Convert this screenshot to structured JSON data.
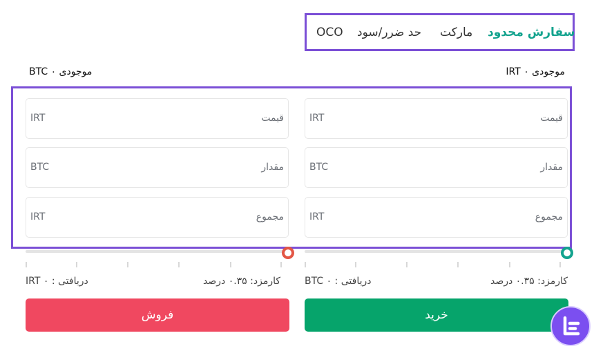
{
  "tabs": [
    {
      "id": "limit",
      "label": "سفارش محدود",
      "active": true
    },
    {
      "id": "market",
      "label": "مارکت",
      "active": false
    },
    {
      "id": "stop",
      "label": "حد ضرر/سود",
      "active": false
    },
    {
      "id": "oco",
      "label": "OCO",
      "active": false
    }
  ],
  "buy": {
    "balance": "موجودی ۰ IRT",
    "price": {
      "label": "قیمت",
      "unit": "IRT"
    },
    "amount": {
      "label": "مقدار",
      "unit": "BTC"
    },
    "total": {
      "label": "مجموع",
      "unit": "IRT"
    },
    "fee": "کارمزد: ۰.۳۵ درصد",
    "receive": "دریافتی : ۰ BTC",
    "button": "خرید"
  },
  "sell": {
    "balance": "موجودی ۰ BTC",
    "price": {
      "label": "قیمت",
      "unit": "IRT"
    },
    "amount": {
      "label": "مقدار",
      "unit": "BTC"
    },
    "total": {
      "label": "مجموع",
      "unit": "IRT"
    },
    "fee": "کارمزد: ۰.۳۵ درصد",
    "receive": "دریافتی : ۰ IRT",
    "button": "فروش"
  },
  "colors": {
    "accent": "#13a38e",
    "buy": "#06a46b",
    "sell": "#f04860",
    "highlight": "#7b4fd6",
    "logo": "#7b4ff0"
  }
}
